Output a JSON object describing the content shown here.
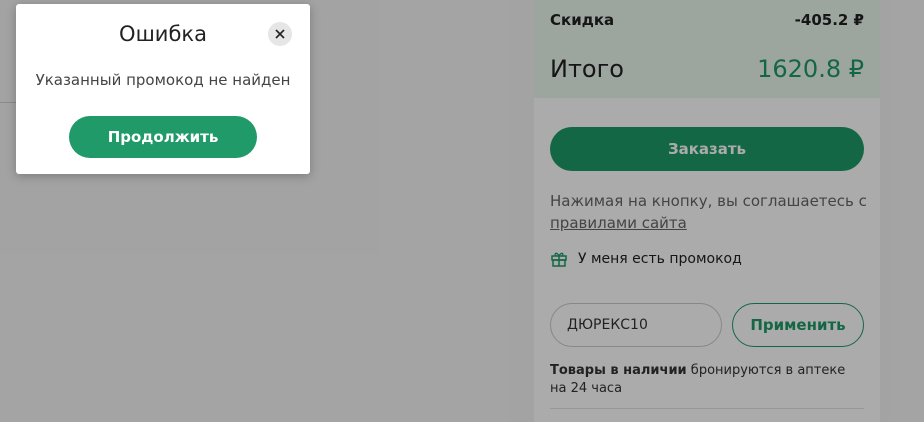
{
  "summary": {
    "discount_label": "Скидка",
    "discount_value": "-405.2 ₽",
    "total_label": "Итого",
    "total_value": "1620.8 ₽",
    "order_button": "Заказать",
    "agree_text": "Нажимая на кнопку, вы соглашаетесь с ",
    "agree_link": "правилами сайта",
    "promo_toggle": "У меня есть промокод",
    "promo_value": "ДЮРЕКС10",
    "apply_button": "Применить",
    "stock_bold": "Товары в наличии",
    "stock_rest": " бронируются в аптеке на 24 часа"
  },
  "modal": {
    "title": "Ошибка",
    "message": "Указанный промокод не найден",
    "continue_button": "Продолжить"
  },
  "colors": {
    "accent": "#1f9a68",
    "summary_highlight": "#eaf6ee"
  }
}
